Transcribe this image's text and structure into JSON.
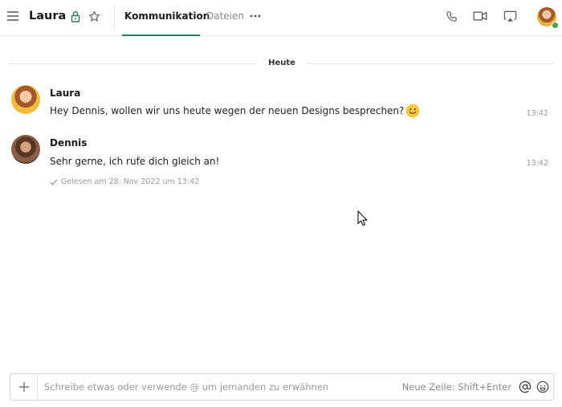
{
  "header": {
    "title": "Laura",
    "tabs": [
      {
        "label": "Kommunikation",
        "active": true
      },
      {
        "label": "Dateien",
        "active": false
      }
    ],
    "icons": [
      "menu-icon",
      "lock-icon",
      "star-icon",
      "more-icon",
      "phone-icon",
      "video-icon",
      "screen-share-icon"
    ],
    "user_status": "online"
  },
  "timeline": {
    "date_divider": "Heute",
    "messages": [
      {
        "sender": "Laura",
        "text": "Hey Dennis, wollen wir uns heute wegen der neuen Designs besprechen?",
        "emoji": "slightly-smiling-face",
        "time": "13:42"
      },
      {
        "sender": "Dennis",
        "text": "Sehr gerne, ich rufe dich gleich an!",
        "time": "13:42",
        "read_receipt": "Gelesen am 28. Nov 2022 um 13:42"
      }
    ]
  },
  "composer": {
    "placeholder": "Schreibe etwas oder verwende @ um jemanden zu erwähnen",
    "value": "",
    "hint": "Neue Zeile: Shift+Enter"
  },
  "colors": {
    "accent": "#2d7a57",
    "presence": "#46a34a",
    "muted_text": "#9a9a9a",
    "divider": "#e3e3e3"
  }
}
